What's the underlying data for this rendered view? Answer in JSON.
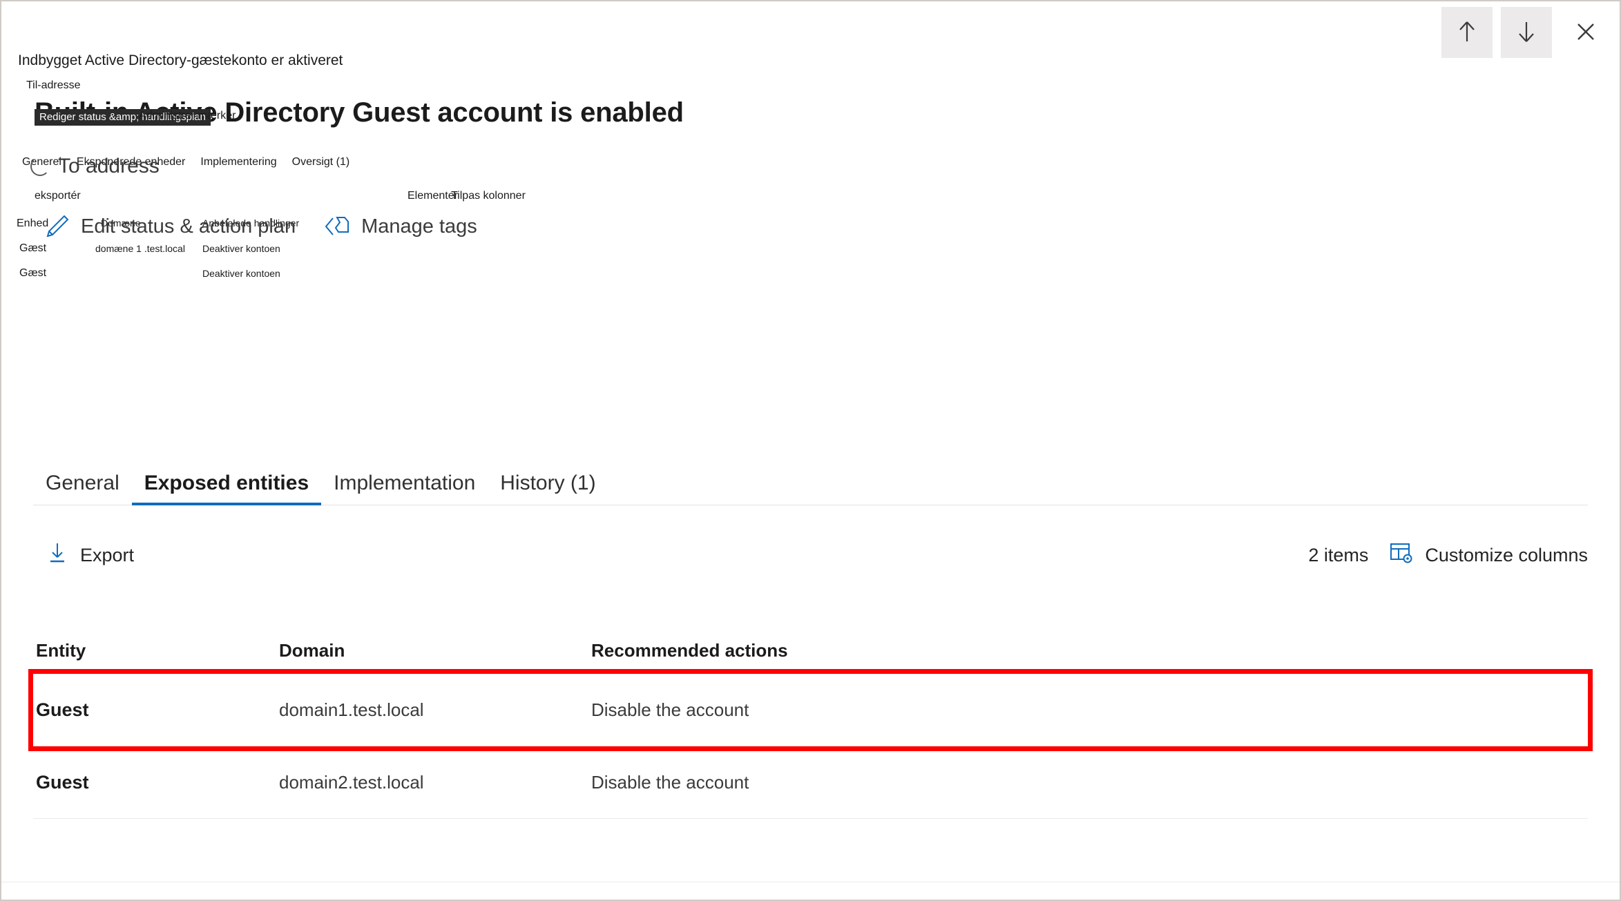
{
  "window": {
    "controls": [
      {
        "name": "previous-item-button",
        "icon": "arrow-up-icon",
        "label": ""
      },
      {
        "name": "next-item-button",
        "icon": "arrow-down-icon",
        "label": ""
      },
      {
        "name": "close-button",
        "icon": "close-icon",
        "label": ""
      }
    ]
  },
  "accent_color": "#0f6cbd",
  "highlight_color": "#ff0000",
  "danish_overlay": {
    "alert_title": "Indbygget Active Directory-gæstekonto er aktiveret",
    "to_address_label": "Til-adresse",
    "tabs": [
      {
        "label": "Generel",
        "active": false
      },
      {
        "label": "Eksponerede enheder",
        "active": true
      },
      {
        "label": "Implementering",
        "active": false
      },
      {
        "label": "Oversigt (1)",
        "active": false
      }
    ],
    "export_label": "eksportér",
    "items_label": "Elementer",
    "customize_columns_label": "Tilpas kolonner",
    "table_headers": {
      "entity": "Enhed",
      "domain": "Domæne",
      "recommended_actions": "Anbefalede handlinger"
    },
    "rows": [
      {
        "entity": "Gæst",
        "domain": "domæne 1 .test.local",
        "action": "Deaktiver kontoen"
      },
      {
        "entity": "Gæst",
        "domain": "",
        "action": "Deaktiver kontoen"
      }
    ],
    "tooltip_chips": [
      {
        "label": "Rediger status &amp; handlingsplan",
        "style": "dark"
      },
      {
        "label": "Administrer mærker",
        "style": "plain"
      }
    ]
  },
  "english_layer": {
    "page_title": "Built-in Active Directory Guest account is enabled",
    "to_address": {
      "label": "To address",
      "icon": "spinner-icon"
    },
    "commands": [
      {
        "label": "Edit status & action plan",
        "icon": "pencil-icon"
      },
      {
        "label": "Manage tags",
        "icon": "tags-icon"
      }
    ],
    "tabs": [
      {
        "label": "General",
        "active": false
      },
      {
        "label": "Exposed entities",
        "active": true
      },
      {
        "label": "Implementation",
        "active": false
      },
      {
        "label": "History (1)",
        "active": false
      }
    ],
    "command_bar": {
      "export_label": "Export",
      "export_icon": "download-arrow-icon",
      "item_count": "2 items",
      "customize_columns_label": "Customize columns",
      "customize_columns_icon": "table-settings-icon"
    },
    "table": {
      "columns": [
        "Entity",
        "Domain",
        "Recommended actions"
      ],
      "rows": [
        {
          "entity": "Guest",
          "domain": "domain1.test.local",
          "action": "Disable the account",
          "highlighted": true
        },
        {
          "entity": "Guest",
          "domain": "domain2.test.local",
          "action": "Disable the account",
          "highlighted": false
        }
      ]
    }
  }
}
